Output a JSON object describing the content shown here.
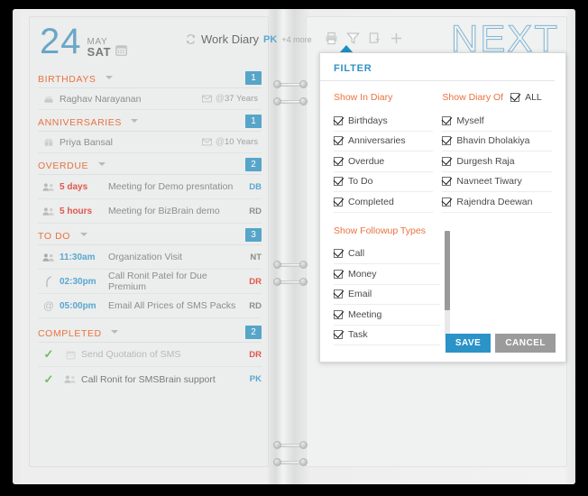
{
  "header": {
    "day": "24",
    "month": "MAY",
    "weekday": "SAT",
    "calendar_icon": "calendar-icon",
    "diary_label": "Work Diary",
    "diary_owner": "PK",
    "diary_more": "+4 more",
    "sync_icon": "sync-icon",
    "watermark": "NEXT"
  },
  "toolbar": {
    "items": [
      {
        "name": "print-icon",
        "label": "Print"
      },
      {
        "name": "filter-icon",
        "label": "Filter"
      },
      {
        "name": "add-note-icon",
        "label": "Add Note"
      },
      {
        "name": "plus-icon",
        "label": "Add"
      }
    ]
  },
  "sections": [
    {
      "title": "BIRTHDAYS",
      "count": "1",
      "rows": [
        {
          "icon": "cake-icon",
          "name": "Raghav Narayanan",
          "mail_icon": "envelope-icon",
          "at_icon": "at-icon",
          "tail": "37 Years"
        }
      ]
    },
    {
      "title": "ANNIVERSARIES",
      "count": "1",
      "rows": [
        {
          "icon": "gift-icon",
          "name": "Priya Bansal",
          "mail_icon": "envelope-icon",
          "at_icon": "at-icon",
          "tail": "10 Years"
        }
      ]
    },
    {
      "title": "OVERDUE",
      "count": "2",
      "rows": [
        {
          "icon": "people-icon",
          "time": "5 days",
          "text": "Meeting for Demo presntation",
          "initials": "DB"
        },
        {
          "icon": "people-icon",
          "time": "5 hours",
          "text": "Meeting for BizBrain demo",
          "initials": "RD"
        }
      ]
    },
    {
      "title": "TO DO",
      "count": "3",
      "rows": [
        {
          "icon": "people-icon",
          "time": "11:30am",
          "text": "Organization Visit",
          "initials": "NT"
        },
        {
          "icon": "phone-icon",
          "time": "02:30pm",
          "text": "Call Ronit Patel for Due Premium",
          "initials": "DR"
        },
        {
          "icon": "at-icon",
          "time": "05:00pm",
          "text": "Email All Prices of SMS Packs",
          "initials": "RD"
        }
      ]
    },
    {
      "title": "COMPLETED",
      "count": "2",
      "rows": [
        {
          "icon": "calendar-icon",
          "check_icon": "check-icon",
          "text": "Send Quotation of SMS",
          "initials": "DR"
        },
        {
          "icon": "people-icon",
          "check_icon": "check-icon",
          "text": "Call Ronit for SMSBrain support",
          "initials": "PK"
        }
      ]
    }
  ],
  "filter": {
    "title": "FILTER",
    "show_in_diary": {
      "label": "Show In Diary",
      "options": [
        {
          "label": "Birthdays",
          "checked": true
        },
        {
          "label": "Anniversaries",
          "checked": true
        },
        {
          "label": "Overdue",
          "checked": true
        },
        {
          "label": "To Do",
          "checked": true
        },
        {
          "label": "Completed",
          "checked": true
        }
      ]
    },
    "show_diary_of": {
      "label": "Show Diary Of",
      "all_label": "ALL",
      "all_checked": true,
      "options": [
        {
          "label": "Myself",
          "checked": true
        },
        {
          "label": "Bhavin Dholakiya",
          "checked": true
        },
        {
          "label": "Durgesh Raja",
          "checked": true
        },
        {
          "label": "Navneet Tiwary",
          "checked": true
        },
        {
          "label": "Rajendra Deewan",
          "checked": true
        }
      ]
    },
    "show_followup_types": {
      "label": "Show Followup Types",
      "options": [
        {
          "label": "Call",
          "checked": true
        },
        {
          "label": "Money",
          "checked": true
        },
        {
          "label": "Email",
          "checked": true
        },
        {
          "label": "Meeting",
          "checked": true
        },
        {
          "label": "Task",
          "checked": true
        }
      ]
    },
    "save_label": "SAVE",
    "cancel_label": "CANCEL"
  },
  "colors": {
    "accent_blue": "#2b93c7",
    "section_orange": "#e8733f",
    "badge_blue": "#57a5c9",
    "overdue_red": "#e0574b",
    "check_green": "#6fbd5f"
  }
}
